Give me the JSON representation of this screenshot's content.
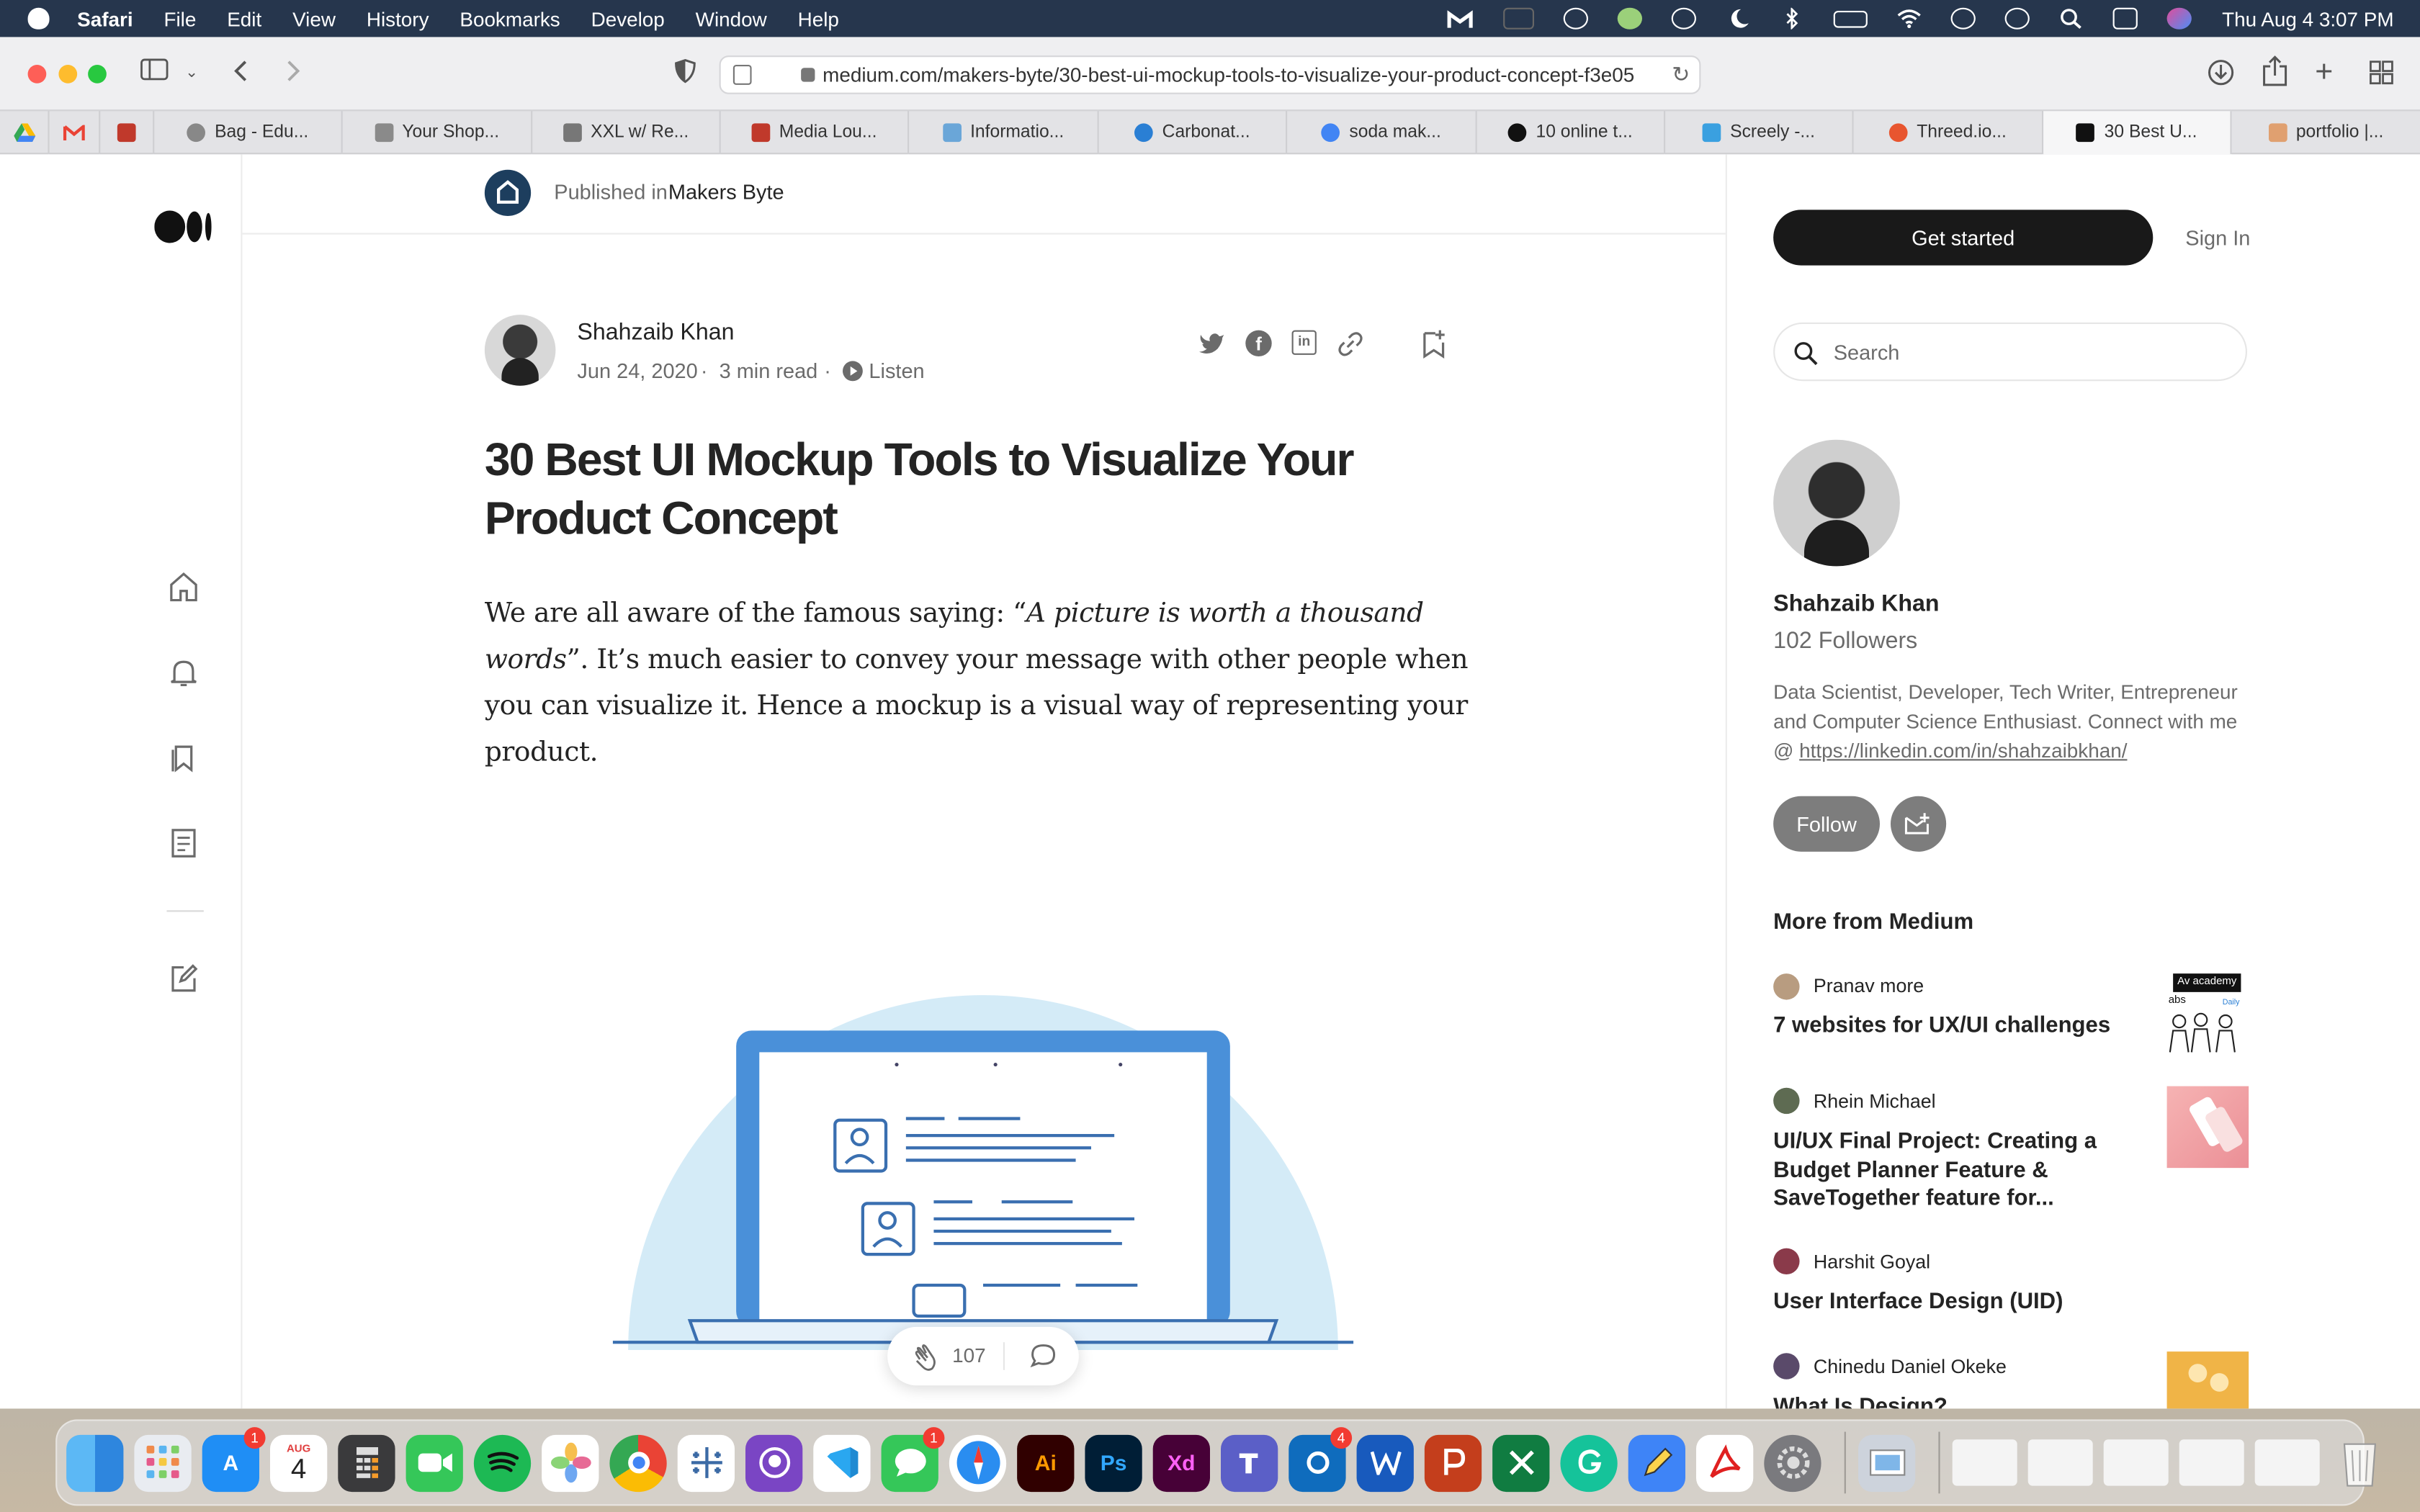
{
  "menubar": {
    "app": "Safari",
    "items": [
      "File",
      "Edit",
      "View",
      "History",
      "Bookmarks",
      "Develop",
      "Window",
      "Help"
    ],
    "clock": "Thu Aug 4  3:07 PM"
  },
  "toolbar": {
    "url": "medium.com/makers-byte/30-best-ui-mockup-tools-to-visualize-your-product-concept-f3e05"
  },
  "tabs": [
    {
      "label": "Bag - Edu...",
      "color": "#888888"
    },
    {
      "label": "Your Shop...",
      "color": "#8a8a8a"
    },
    {
      "label": "XXL w/ Re...",
      "color": "#777777"
    },
    {
      "label": "Media Lou...",
      "color": "#c0392b"
    },
    {
      "label": "Informatio...",
      "color": "#6aa6d8"
    },
    {
      "label": "Carbonat...",
      "color": "#2a7fd4"
    },
    {
      "label": "soda mak...",
      "color": "#4285f4"
    },
    {
      "label": "10 online t...",
      "color": "#111111"
    },
    {
      "label": "Screely -...",
      "color": "#3aa0e0"
    },
    {
      "label": "Threed.io...",
      "color": "#e8552f"
    },
    {
      "label": "30 Best U...",
      "color": "#111111"
    },
    {
      "label": "portfolio |...",
      "color": "#e0a070"
    }
  ],
  "publication": {
    "prefix": "Published in",
    "name": "Makers Byte"
  },
  "article": {
    "author": "Shahzaib Khan",
    "date": "Jun 24, 2020",
    "read_time": "3 min read",
    "listen": "Listen",
    "title": "30 Best UI Mockup Tools to Visualize Your Product Concept",
    "body_before": "We are all aware of the famous saying: “",
    "body_quote": "A picture is worth a thousand words",
    "body_after": "”. It’s much easier to convey your message with other people when you can visualize it. Hence a mockup is a visual way of representing your product.",
    "claps": "107"
  },
  "sidebar": {
    "get_started": "Get started",
    "sign_in": "Sign In",
    "search_placeholder": "Search",
    "author_name": "Shahzaib Khan",
    "followers": "102 Followers",
    "bio": "Data Scientist, Developer, Tech Writer, Entrepreneur and Computer Science Enthusiast. Connect with me @ ",
    "bio_link": "https://linkedin.com/in/shahzaibkhan/",
    "follow": "Follow",
    "more_heading": "More from Medium",
    "more": [
      {
        "author": "Pranav more",
        "title": "7 websites for UX/UI challenges"
      },
      {
        "author": "Rhein Michael",
        "title": "UI/UX Final Project: Creating a Budget Planner Feature & SaveTogether feature for..."
      },
      {
        "author": "Harshit Goyal",
        "title": "User Interface Design (UID)"
      },
      {
        "author": "Chinedu Daniel Okeke",
        "title": "What Is Design?"
      }
    ],
    "thumb1_text": "Av academy",
    "thumb1_labels": [
      "abs",
      "Daily"
    ]
  },
  "dock": {
    "calendar_month": "AUG",
    "calendar_day": "4",
    "appstore_badge": "1",
    "messages_badge": "1",
    "outlook_badge": "4",
    "ai_label": "Ai",
    "ps_label": "Ps",
    "xd_label": "Xd"
  }
}
